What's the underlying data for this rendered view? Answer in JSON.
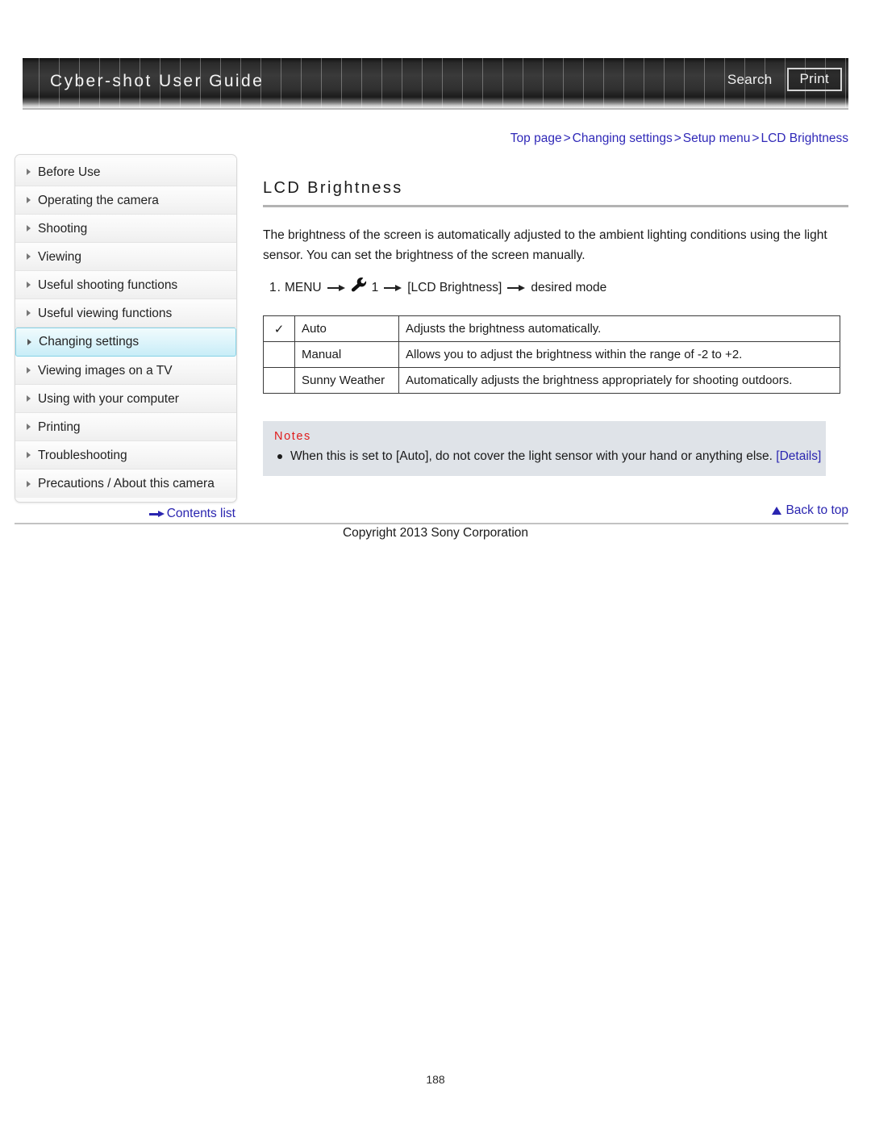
{
  "header": {
    "title": "Cyber-shot User Guide",
    "search_label": "Search",
    "print_label": "Print"
  },
  "breadcrumb": {
    "items": [
      "Top page",
      "Changing settings",
      "Setup menu",
      "LCD Brightness"
    ],
    "separator": ">"
  },
  "sidebar": {
    "items": [
      {
        "label": "Before Use",
        "active": false
      },
      {
        "label": "Operating the camera",
        "active": false
      },
      {
        "label": "Shooting",
        "active": false
      },
      {
        "label": "Viewing",
        "active": false
      },
      {
        "label": "Useful shooting functions",
        "active": false
      },
      {
        "label": "Useful viewing functions",
        "active": false
      },
      {
        "label": "Changing settings",
        "active": true
      },
      {
        "label": "Viewing images on a TV",
        "active": false
      },
      {
        "label": "Using with your computer",
        "active": false
      },
      {
        "label": "Printing",
        "active": false
      },
      {
        "label": "Troubleshooting",
        "active": false
      },
      {
        "label": "Precautions / About this camera",
        "active": false
      }
    ],
    "contents_list_label": "Contents list"
  },
  "main": {
    "page_title": "LCD Brightness",
    "intro": "The brightness of the screen is automatically adjusted to the ambient lighting conditions using the light sensor. You can set the brightness of the screen manually.",
    "step": {
      "number": "1.",
      "part1": "MENU",
      "icon": "wrench-icon",
      "part2": "1",
      "part3": "[LCD Brightness]",
      "part4": "desired mode"
    },
    "table": {
      "rows": [
        {
          "checked": true,
          "check_glyph": "✓",
          "mode": "Auto",
          "description": "Adjusts the brightness automatically."
        },
        {
          "checked": false,
          "check_glyph": "",
          "mode": "Manual",
          "description": "Allows you to adjust the brightness within the range of -2 to +2."
        },
        {
          "checked": false,
          "check_glyph": "",
          "mode": "Sunny Weather",
          "description": "Automatically adjusts the brightness appropriately for shooting outdoors."
        }
      ]
    },
    "notes": {
      "title": "Notes",
      "items": [
        {
          "text": "When this is set to [Auto], do not cover the light sensor with your hand or anything else.",
          "link": "[Details]"
        }
      ]
    }
  },
  "footer": {
    "back_to_top_label": "Back to top",
    "copyright": "Copyright 2013 Sony Corporation",
    "page_number": "188"
  },
  "colors": {
    "link": "#2a25b0",
    "breadcrumb": "#3029b8",
    "notes_title": "#e01b1b",
    "notes_bg": "#dfe3e8",
    "active_nav": "#c8edf7"
  }
}
